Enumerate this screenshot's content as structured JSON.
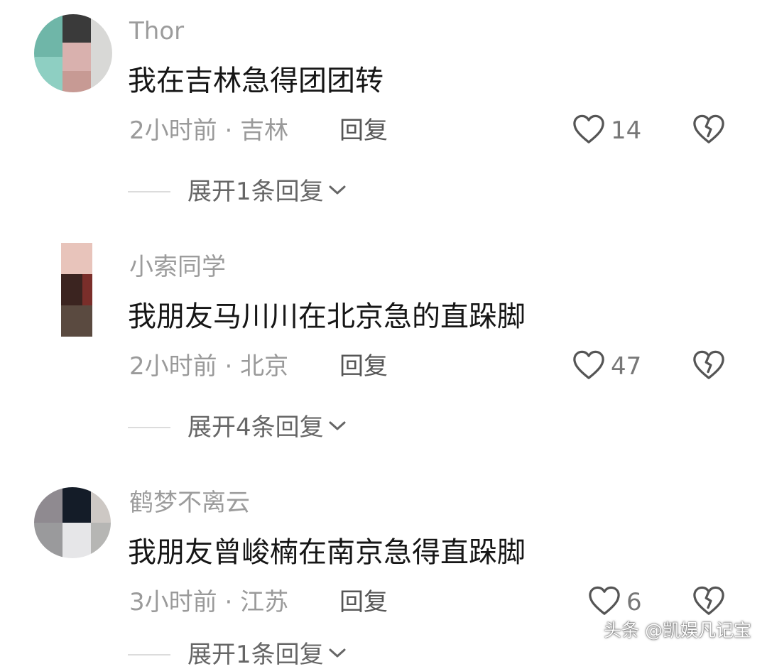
{
  "comments": [
    {
      "username": "Thor",
      "text": "我在吉林急得团团转",
      "time": "2小时前",
      "location": "吉林",
      "reply_label": "回复",
      "likes": "14",
      "expand_label": "展开1条回复"
    },
    {
      "username": "小索同学",
      "text": "我朋友马川川在北京急的直跺脚",
      "time": "2小时前",
      "location": "北京",
      "reply_label": "回复",
      "likes": "47",
      "expand_label": "展开4条回复"
    },
    {
      "username": "鹤梦不离云",
      "text": "我朋友曾峻楠在南京急得直跺脚",
      "time": "3小时前",
      "location": "江苏",
      "reply_label": "回复",
      "likes": "6",
      "expand_label": "展开1条回复"
    }
  ],
  "meta_separator": " · ",
  "watermark": "头条 @凯娱凡记宝",
  "icons": {
    "like": "heart-outline-icon",
    "dislike": "broken-heart-icon",
    "expand": "chevron-down-icon"
  },
  "colors": {
    "username": "#9c9c9c",
    "text": "#161616",
    "meta": "#9a9a9a",
    "icon": "#555555"
  }
}
